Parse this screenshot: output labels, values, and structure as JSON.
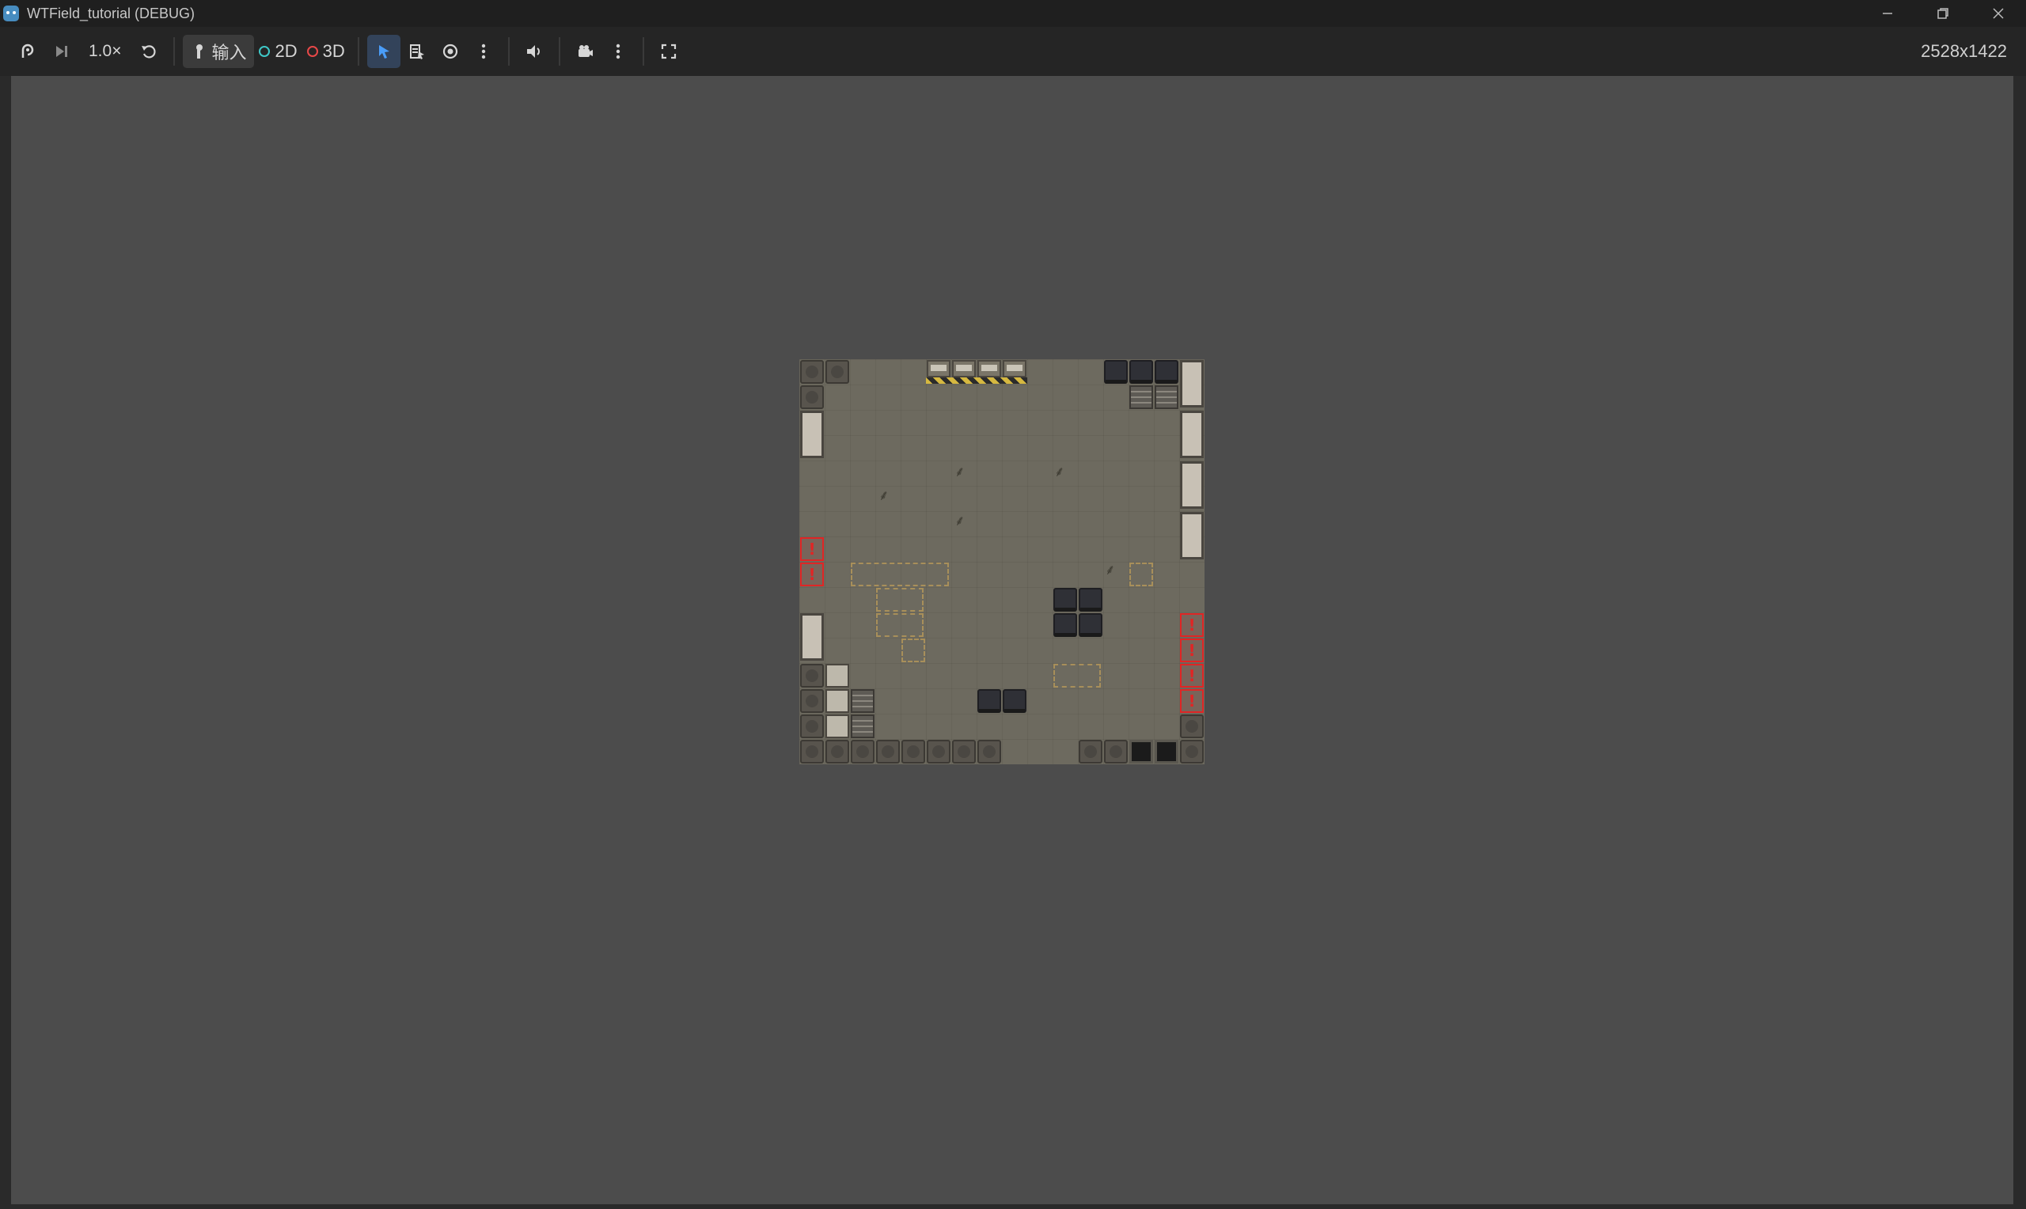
{
  "window": {
    "title": "WTField_tutorial (DEBUG)",
    "controls": [
      "minimize",
      "restore",
      "close"
    ]
  },
  "toolbar": {
    "speed_label": "1.0×",
    "input_label": "输入",
    "mode_2d_label": "2D",
    "mode_3d_label": "3D",
    "resolution_label": "2528x1422",
    "icons": [
      "remote-debug-icon",
      "next-frame-icon",
      "reset-icon",
      "input-icon",
      "select-icon",
      "list-select-icon",
      "visibility-icon",
      "more-icon",
      "audio-icon",
      "camera-icon",
      "more-icon",
      "fullscreen-icon"
    ],
    "accent_color": "#4a9df8",
    "mode_2d_color": "#3fc8c8",
    "mode_3d_color": "#e84848"
  },
  "viewport": {
    "background": "#4c4c4c"
  },
  "map": {
    "floor_color": "#6d6a5f",
    "alarm_color": "#e02525"
  }
}
